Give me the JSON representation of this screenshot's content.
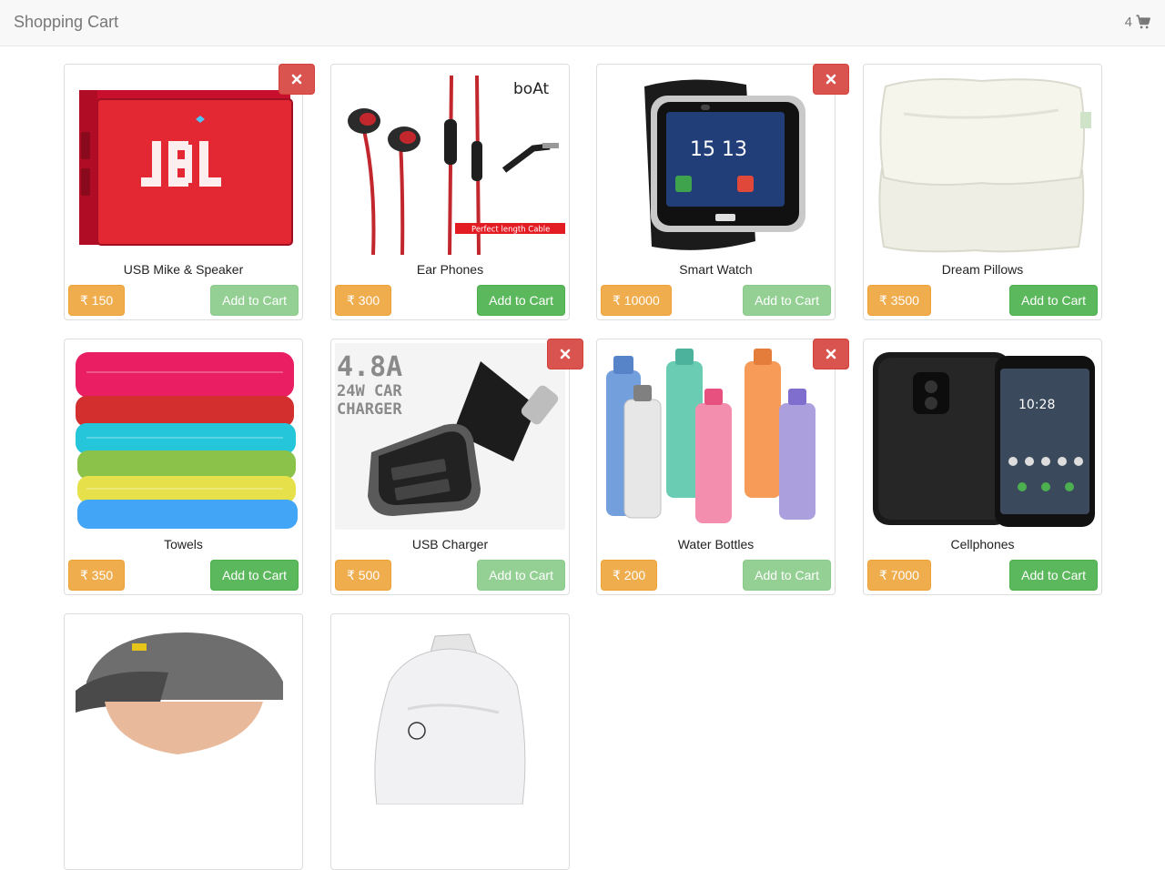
{
  "navbar": {
    "brand": "Shopping Cart",
    "cart_count": "4"
  },
  "currency": "₹",
  "products": [
    {
      "name": "USB Mike & Speaker",
      "price": "₹ 150",
      "action": "Add to Cart",
      "in_cart": true,
      "image": "jbl-speaker"
    },
    {
      "name": "Ear Phones",
      "price": "₹ 300",
      "action": "Add to Cart",
      "in_cart": false,
      "image": "earphones",
      "image_text": {
        "brand": "boAt",
        "tag": "Perfect length Cable"
      }
    },
    {
      "name": "Smart Watch",
      "price": "₹ 10000",
      "action": "Add to Cart",
      "in_cart": true,
      "image": "smart-watch",
      "image_text": {
        "time": "15 13"
      }
    },
    {
      "name": "Dream Pillows",
      "price": "₹ 3500",
      "action": "Add to Cart",
      "in_cart": false,
      "image": "pillows"
    },
    {
      "name": "Towels",
      "price": "₹ 350",
      "action": "Add to Cart",
      "in_cart": false,
      "image": "towels"
    },
    {
      "name": "USB Charger",
      "price": "₹ 500",
      "action": "Add to Cart",
      "in_cart": true,
      "image": "car-charger",
      "image_text": {
        "line1": "4.8A",
        "line2": "24W CAR",
        "line3": "CHARGER"
      }
    },
    {
      "name": "Water Bottles",
      "price": "₹ 200",
      "action": "Add to Cart",
      "in_cart": true,
      "image": "water-bottles"
    },
    {
      "name": "Cellphones",
      "price": "₹ 7000",
      "action": "Add to Cart",
      "in_cart": false,
      "image": "cellphone",
      "image_text": {
        "time": "10:28"
      }
    },
    {
      "name": "",
      "price": "",
      "action": "",
      "in_cart": false,
      "image": "beanie-cap"
    },
    {
      "name": "",
      "price": "",
      "action": "",
      "in_cart": false,
      "image": "bean-bag-refill"
    }
  ],
  "icons": {
    "remove": "times-icon",
    "cart": "shopping-cart-icon"
  },
  "colors": {
    "price": "#f0ad4e",
    "add": "#5cb85c",
    "remove": "#d9534f"
  }
}
